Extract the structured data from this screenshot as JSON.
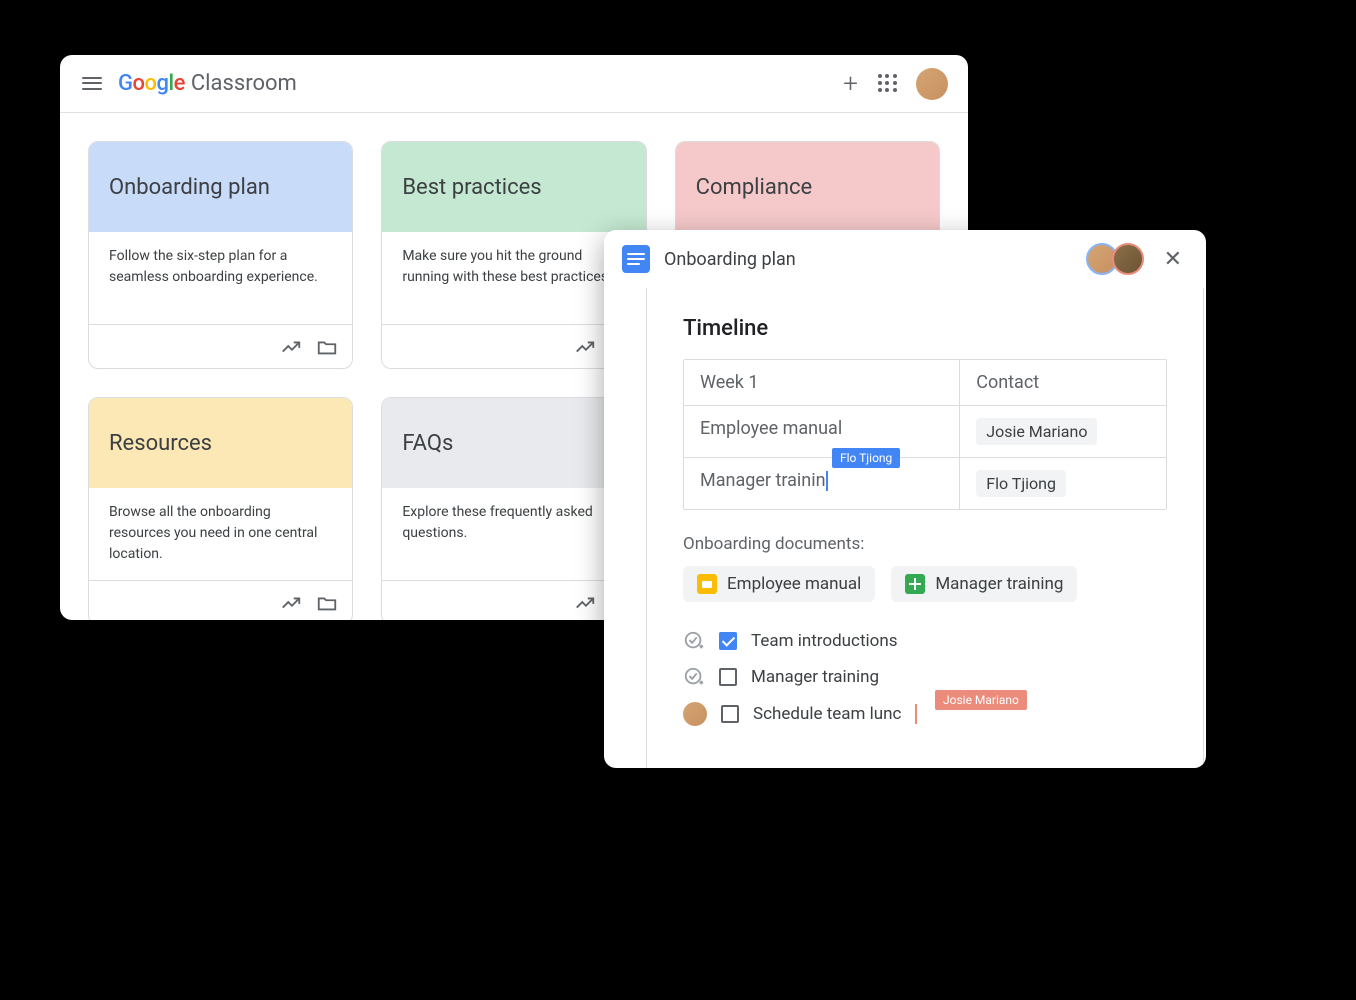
{
  "classroom": {
    "brand_product": "Classroom",
    "cards": [
      {
        "title": "Onboarding plan",
        "desc": "Follow the six-step plan for a seamless onboarding experience.",
        "bg": "bg-blue"
      },
      {
        "title": "Best practices",
        "desc": "Make sure you hit the ground running with these best practices.",
        "bg": "bg-green"
      },
      {
        "title": "Compliance",
        "desc": "",
        "bg": "bg-pink"
      },
      {
        "title": "Resources",
        "desc": "Browse all the onboarding resources you need in one central location.",
        "bg": "bg-yellow"
      },
      {
        "title": "FAQs",
        "desc": "Explore these frequently asked questions.",
        "bg": "bg-grey"
      }
    ]
  },
  "doc": {
    "title": "Onboarding plan",
    "heading": "Timeline",
    "table": {
      "headers": [
        "Week 1",
        "Contact"
      ],
      "rows": [
        {
          "item": "Employee manual",
          "contact": "Josie Mariano"
        },
        {
          "item": "Manager trainin",
          "contact": "Flo Tjiong"
        }
      ]
    },
    "cursor1_label": "Flo Tjiong",
    "cursor2_label": "Josie Mariano",
    "section_label": "Onboarding documents:",
    "chips": [
      {
        "label": "Employee manual",
        "type": "slides"
      },
      {
        "label": "Manager training",
        "type": "sheets"
      }
    ],
    "checklist": [
      {
        "label": "Team introductions",
        "checked": true
      },
      {
        "label": "Manager training",
        "checked": false
      },
      {
        "label": "Schedule team lunc",
        "checked": false
      }
    ],
    "collaborators": [
      {
        "border": "#8ab4f8",
        "bg": "linear-gradient(135deg,#d4a574,#c89060)"
      },
      {
        "border": "#ea8b7c",
        "bg": "linear-gradient(135deg,#8b6f47,#6b5436)"
      }
    ]
  },
  "colors": {
    "blue": "#4285f4",
    "red": "#ea4335",
    "yellow": "#fbbc05",
    "green": "#34a853"
  }
}
